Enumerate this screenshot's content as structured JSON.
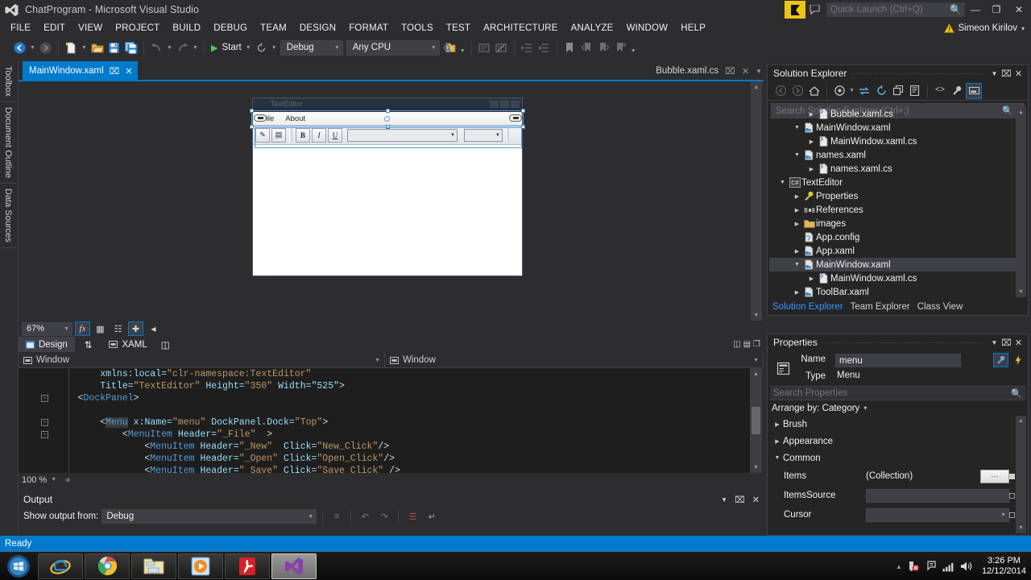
{
  "titlebar": {
    "app_title": "ChatProgram - Microsoft Visual Studio",
    "logo_icon": "visual-studio-logo-icon",
    "feedback_flag_icon": "feedback-flag-icon",
    "feedback_bubble_icon": "feedback-bubble-icon",
    "minimize_label": "—",
    "restore_label": "❐",
    "close_label": "✕"
  },
  "quick_launch": {
    "placeholder": "Quick Launch (Ctrl+Q)",
    "value": "",
    "search_icon": "magnifier-icon"
  },
  "menubar": {
    "items": [
      {
        "label": "FILE"
      },
      {
        "label": "EDIT"
      },
      {
        "label": "VIEW"
      },
      {
        "label": "PROJECT"
      },
      {
        "label": "BUILD"
      },
      {
        "label": "DEBUG"
      },
      {
        "label": "TEAM"
      },
      {
        "label": "DESIGN"
      },
      {
        "label": "FORMAT"
      },
      {
        "label": "TOOLS"
      },
      {
        "label": "TEST"
      },
      {
        "label": "ARCHITECTURE"
      },
      {
        "label": "ANALYZE"
      },
      {
        "label": "WINDOW"
      },
      {
        "label": "HELP"
      }
    ],
    "account_name": "Simeon Kirilov",
    "account_warning_icon": "warning-triangle-icon",
    "account_chevron": "▾"
  },
  "toolbar": {
    "navigate_back_icon": "navigate-back-icon",
    "navigate_forward_icon": "navigate-forward-icon",
    "new_project_icon": "new-project-icon",
    "open_file_icon": "open-file-icon",
    "save_icon": "save-icon",
    "save_all_icon": "save-all-icon",
    "undo_icon": "undo-icon",
    "redo_icon": "redo-icon",
    "start_label": "Start",
    "start_icon": "play-triangle-icon",
    "restart_icon": "restart-icon",
    "config_value": "Debug",
    "platform_value": "Any CPU",
    "find_icon": "find-in-files-icon",
    "comment_icon": "comment-selection-icon",
    "uncomment_icon": "uncomment-selection-icon",
    "indent_icon": "increase-indent-icon",
    "outdent_icon": "decrease-indent-icon",
    "bookmark_icon": "bookmark-icon",
    "prev_bookmark_icon": "previous-bookmark-icon",
    "next_bookmark_icon": "next-bookmark-icon",
    "clear_bookmarks_icon": "clear-bookmarks-icon",
    "overflow_icon": "toolbar-overflow-icon"
  },
  "leftrail": {
    "tabs": [
      {
        "label": "Toolbox"
      },
      {
        "label": "Document Outline"
      },
      {
        "label": "Data Sources"
      }
    ]
  },
  "tabstrip": {
    "active_tab": "MainWindow.xaml",
    "pin_icon": "pin-icon",
    "close_icon": "close-icon",
    "inactive_tab": "Bubble.xaml.cs",
    "inactive_pin_icon": "pin-icon",
    "inactive_close_icon": "close-icon",
    "dropdown_icon": "chevron-down-icon"
  },
  "designer": {
    "preview_window": {
      "title": "TextEditor",
      "menu_items": [
        {
          "label": "File"
        },
        {
          "label": "About"
        }
      ],
      "toolbar_buttons": [
        {
          "label": "✎",
          "name": "open-icon"
        },
        {
          "label": "▤",
          "name": "save-icon"
        },
        {
          "label": "B",
          "name": "bold-button"
        },
        {
          "label": "I",
          "name": "italic-button"
        },
        {
          "label": "U",
          "name": "underline-button"
        }
      ],
      "font_family_value": "",
      "font_size_value": ""
    }
  },
  "zoombar": {
    "zoom_value": "67%",
    "effects_icon": "fx-effects-icon",
    "grid_icon": "snap-to-grid-icon",
    "snaplines_icon": "snap-to-snaplines-icon",
    "artboard_icon": "artboard-icon",
    "collapse_icon": "collapse-pane-icon"
  },
  "split_tabs": {
    "design_label": "Design",
    "design_icon": "design-view-icon",
    "swap_icon": "swap-panes-icon",
    "xaml_label": "XAML",
    "xaml_icon": "xaml-view-icon",
    "split_icon": "split-horizontal-icon",
    "right_icons": [
      {
        "name": "vertical-split-icon",
        "glyph": "◫"
      },
      {
        "name": "horizontal-split-icon",
        "glyph": "▤"
      },
      {
        "name": "expand-icon",
        "glyph": "❐"
      }
    ]
  },
  "xaml_editor": {
    "nav_left": "Window",
    "nav_right": "Window",
    "nav_icon": "element-icon",
    "zoom_value": "100 %",
    "lines": [
      {
        "glyph": "",
        "tokens": [
          {
            "t": "        xmlns:local=",
            "c": "attr"
          },
          {
            "t": "\"clr-namespace:TextEditor\"",
            "c": "str"
          }
        ]
      },
      {
        "glyph": "",
        "tokens": [
          {
            "t": "        Title=",
            "c": "attr"
          },
          {
            "t": "\"TextEditor\"",
            "c": "str"
          },
          {
            "t": " Height=",
            "c": "attr"
          },
          {
            "t": "\"350\"",
            "c": "str"
          },
          {
            "t": " Width=",
            "c": "attr"
          },
          {
            "t": "\"525\"",
            "c": "attr"
          },
          {
            "t": ">",
            "c": "punct"
          }
        ]
      },
      {
        "glyph": "-",
        "tokens": [
          {
            "t": "    <",
            "c": "punct"
          },
          {
            "t": "DockPanel",
            "c": "tag"
          },
          {
            "t": ">",
            "c": "punct"
          }
        ]
      },
      {
        "glyph": "",
        "tokens": []
      },
      {
        "glyph": "-",
        "tokens": [
          {
            "t": "        <",
            "c": "punct"
          },
          {
            "t": "Menu",
            "c": "tag-hl"
          },
          {
            "t": " x:Name=",
            "c": "attr"
          },
          {
            "t": "\"menu\"",
            "c": "str"
          },
          {
            "t": " DockPanel.Dock=",
            "c": "attr"
          },
          {
            "t": "\"Top\"",
            "c": "str"
          },
          {
            "t": ">",
            "c": "punct"
          }
        ]
      },
      {
        "glyph": "-",
        "tokens": [
          {
            "t": "            <",
            "c": "punct"
          },
          {
            "t": "MenuItem",
            "c": "tag"
          },
          {
            "t": " Header=",
            "c": "attr"
          },
          {
            "t": "\"_File\"",
            "c": "str"
          },
          {
            "t": "  >",
            "c": "punct"
          }
        ]
      },
      {
        "glyph": "",
        "tokens": [
          {
            "t": "                <",
            "c": "punct"
          },
          {
            "t": "MenuItem",
            "c": "tag"
          },
          {
            "t": " Header=",
            "c": "attr"
          },
          {
            "t": "\"_New\"",
            "c": "str"
          },
          {
            "t": "  Click=",
            "c": "attr"
          },
          {
            "t": "\"New_Click\"",
            "c": "str"
          },
          {
            "t": "/>",
            "c": "punct"
          }
        ]
      },
      {
        "glyph": "",
        "tokens": [
          {
            "t": "                <",
            "c": "punct"
          },
          {
            "t": "MenuItem",
            "c": "tag"
          },
          {
            "t": " Header=",
            "c": "attr"
          },
          {
            "t": "\"_Open\"",
            "c": "str"
          },
          {
            "t": " Click=",
            "c": "attr"
          },
          {
            "t": "\"Open_Click\"",
            "c": "str"
          },
          {
            "t": "/>",
            "c": "punct"
          }
        ]
      },
      {
        "glyph": "",
        "tokens": [
          {
            "t": "                <",
            "c": "punct"
          },
          {
            "t": "MenuItem",
            "c": "tag"
          },
          {
            "t": " Header=",
            "c": "attr"
          },
          {
            "t": "\" Save\"",
            "c": "str"
          },
          {
            "t": " Click=",
            "c": "attr"
          },
          {
            "t": "\"Save Click\"",
            "c": "str"
          },
          {
            "t": " />",
            "c": "punct"
          }
        ]
      }
    ]
  },
  "output": {
    "title": "Output",
    "show_output_label": "Show output from:",
    "source_value": "Debug",
    "dropdown_icon": "chevron-down-icon",
    "pin_icon": "pin-icon",
    "close_icon": "close-icon",
    "find_message_icon": "find-message-icon",
    "go_prev_icon": "go-to-previous-icon",
    "go_next_icon": "go-to-next-icon",
    "clear_all_icon": "clear-all-icon",
    "toggle_wordwrap_icon": "toggle-word-wrap-icon"
  },
  "solution_explorer": {
    "title": "Solution Explorer",
    "dropdown_icon": "chevron-down-icon",
    "pin_icon": "pin-icon",
    "close_icon": "close-icon",
    "toolbar": [
      {
        "name": "back-icon",
        "glyph": "◀"
      },
      {
        "name": "forward-icon",
        "glyph": "▶"
      },
      {
        "name": "home-icon",
        "glyph": "⌂"
      },
      {
        "name": "pending-changes-icon",
        "glyph": "◔"
      },
      {
        "name": "sync-with-active-document-icon",
        "glyph": "⇄"
      },
      {
        "name": "refresh-icon",
        "glyph": "↻"
      },
      {
        "name": "collapse-all-icon",
        "glyph": "⧉"
      },
      {
        "name": "show-all-files-icon",
        "glyph": "☰"
      },
      {
        "name": "view-code-icon",
        "glyph": "<>"
      },
      {
        "name": "properties-icon",
        "glyph": "⚒"
      },
      {
        "name": "preview-selected-items-icon",
        "glyph": "▬"
      }
    ],
    "search_placeholder": "Search Solution Explorer (Ctrl+;)",
    "search_value": "",
    "search_icon": "magnifier-icon",
    "tree": [
      {
        "indent": 2,
        "expander": "collapsed",
        "icon": "cs-file-icon",
        "label": "Bubble.xaml.cs",
        "selected": false
      },
      {
        "indent": 1,
        "expander": "expanded",
        "icon": "xaml-file-icon",
        "label": "MainWindow.xaml",
        "selected": false
      },
      {
        "indent": 2,
        "expander": "collapsed",
        "icon": "cs-file-icon",
        "label": "MainWindow.xaml.cs",
        "selected": false
      },
      {
        "indent": 1,
        "expander": "expanded",
        "icon": "xaml-file-icon",
        "label": "names.xaml",
        "selected": false
      },
      {
        "indent": 2,
        "expander": "collapsed",
        "icon": "cs-file-icon",
        "label": "names.xaml.cs",
        "selected": false
      },
      {
        "indent": 0,
        "expander": "expanded",
        "icon": "csharp-project-icon",
        "label": "TextEditor",
        "selected": false
      },
      {
        "indent": 1,
        "expander": "collapsed",
        "icon": "properties-wrench-icon",
        "label": "Properties",
        "selected": false
      },
      {
        "indent": 1,
        "expander": "collapsed",
        "icon": "references-icon",
        "label": "References",
        "selected": false
      },
      {
        "indent": 1,
        "expander": "collapsed",
        "icon": "folder-icon",
        "label": "images",
        "selected": false
      },
      {
        "indent": 1,
        "expander": "none",
        "icon": "config-file-icon",
        "label": "App.config",
        "selected": false
      },
      {
        "indent": 1,
        "expander": "collapsed",
        "icon": "xaml-file-icon",
        "label": "App.xaml",
        "selected": false
      },
      {
        "indent": 1,
        "expander": "expanded",
        "icon": "xaml-file-icon",
        "label": "MainWindow.xaml",
        "selected": true
      },
      {
        "indent": 2,
        "expander": "collapsed",
        "icon": "cs-file-icon",
        "label": "MainWindow.xaml.cs",
        "selected": false
      },
      {
        "indent": 1,
        "expander": "collapsed",
        "icon": "xaml-file-icon",
        "label": "ToolBar.xaml",
        "selected": false
      }
    ],
    "tabs": [
      {
        "label": "Solution Explorer",
        "active": true
      },
      {
        "label": "Team Explorer",
        "active": false
      },
      {
        "label": "Class View",
        "active": false
      }
    ]
  },
  "properties": {
    "title": "Properties",
    "dropdown_icon": "chevron-down-icon",
    "pin_icon": "pin-icon",
    "close_icon": "close-icon",
    "object_icon": "menu-object-icon",
    "name_label": "Name",
    "name_value": "menu",
    "type_label": "Type",
    "type_value": "Menu",
    "properties_tool_icon": "wrench-properties-icon",
    "events_tool_icon": "lightning-events-icon",
    "search_placeholder": "Search Properties",
    "search_value": "",
    "search_icon": "magnifier-icon",
    "arrange_label": "Arrange by: Category",
    "arrange_chevron": "▾",
    "categories": [
      {
        "label": "Brush",
        "expanded": false
      },
      {
        "label": "Appearance",
        "expanded": false
      },
      {
        "label": "Common",
        "expanded": true
      }
    ],
    "rows": [
      {
        "label": "Items",
        "value": "(Collection)",
        "kind": "collection",
        "marker": "filled"
      },
      {
        "label": "ItemsSource",
        "value": "",
        "kind": "text",
        "marker": "hollow"
      },
      {
        "label": "Cursor",
        "value": "",
        "kind": "dropdown",
        "marker": "hollow"
      }
    ]
  },
  "statusbar": {
    "message": "Ready"
  },
  "taskbar": {
    "start_icon": "windows-start-orb-icon",
    "apps": [
      {
        "name": "internet-explorer-icon",
        "active": false
      },
      {
        "name": "google-chrome-icon",
        "active": false
      },
      {
        "name": "windows-explorer-icon",
        "active": false
      },
      {
        "name": "media-player-icon",
        "active": false
      },
      {
        "name": "adobe-reader-icon",
        "active": false
      },
      {
        "name": "visual-studio-icon",
        "active": true
      }
    ],
    "tray": [
      {
        "name": "show-hidden-icons-icon",
        "glyph": "▲"
      },
      {
        "name": "antivirus-icon",
        "glyph": "◩"
      },
      {
        "name": "action-center-icon",
        "glyph": "⚑"
      },
      {
        "name": "network-icon",
        "glyph": "◢"
      },
      {
        "name": "volume-icon",
        "glyph": "🔊"
      }
    ],
    "clock_time": "3:26 PM",
    "clock_date": "12/12/2014"
  },
  "colors": {
    "accent": "#007acc",
    "chrome": "#2d2d30",
    "panel": "#252526",
    "editor": "#1e1e1e",
    "feedback_yellow": "#f0c417"
  }
}
